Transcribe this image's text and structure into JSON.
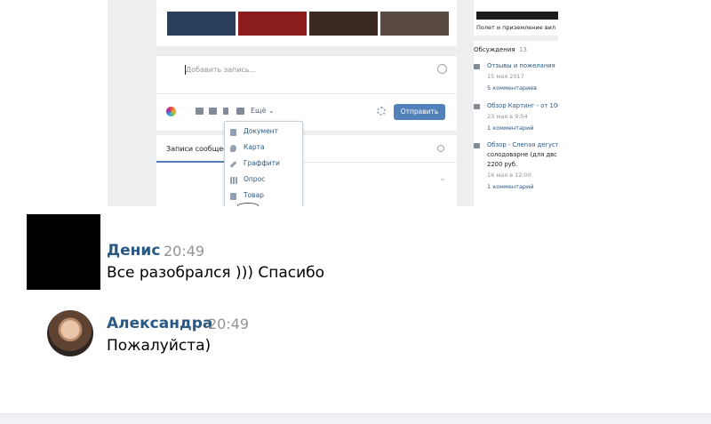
{
  "screenshot": {
    "post_placeholder": "Добавить запись...",
    "more_label": "Ещё",
    "send_label": "Отправить",
    "feed_tab": "Записи сообщест",
    "dropdown_items": [
      {
        "label": "Документ",
        "icon": "document-icon"
      },
      {
        "label": "Карта",
        "icon": "map-pin-icon"
      },
      {
        "label": "Граффити",
        "icon": "brush-icon"
      },
      {
        "label": "Опрос",
        "icon": "poll-icon"
      },
      {
        "label": "Товар",
        "icon": "bag-icon"
      }
    ],
    "sidebar": {
      "photo_caption": "Полет и приземление вил",
      "discussions_title": "Обсуждения",
      "discussions_count": "13",
      "topics": [
        {
          "title": "Отзывы и пожелания",
          "meta": "15 мая 2017",
          "comments": "5 комментариев"
        },
        {
          "title": "Обзор Картинг - от 100",
          "meta": "23 мая в 9:54",
          "comments": "1 комментарий"
        },
        {
          "title": "Обзор - Слепая дегуст",
          "title2": "солодоварне (для двс",
          "title3": "2200 руб.",
          "meta": "16 мая в 12:00",
          "comments": "1 комментарий"
        }
      ]
    },
    "photo_colors": [
      "#2a3f5a",
      "#8c1d1d",
      "#3a2a22",
      "#5a4a44"
    ]
  },
  "messages": [
    {
      "author": "Денис",
      "time": "20:49",
      "text": "Все разобрался ))) Спасибо"
    },
    {
      "author": "Александра",
      "time": "20:49",
      "text": "Пожалуйста)"
    }
  ],
  "colors": {
    "accent": "#5181b8",
    "link": "#2a5885",
    "muted": "#939393"
  }
}
